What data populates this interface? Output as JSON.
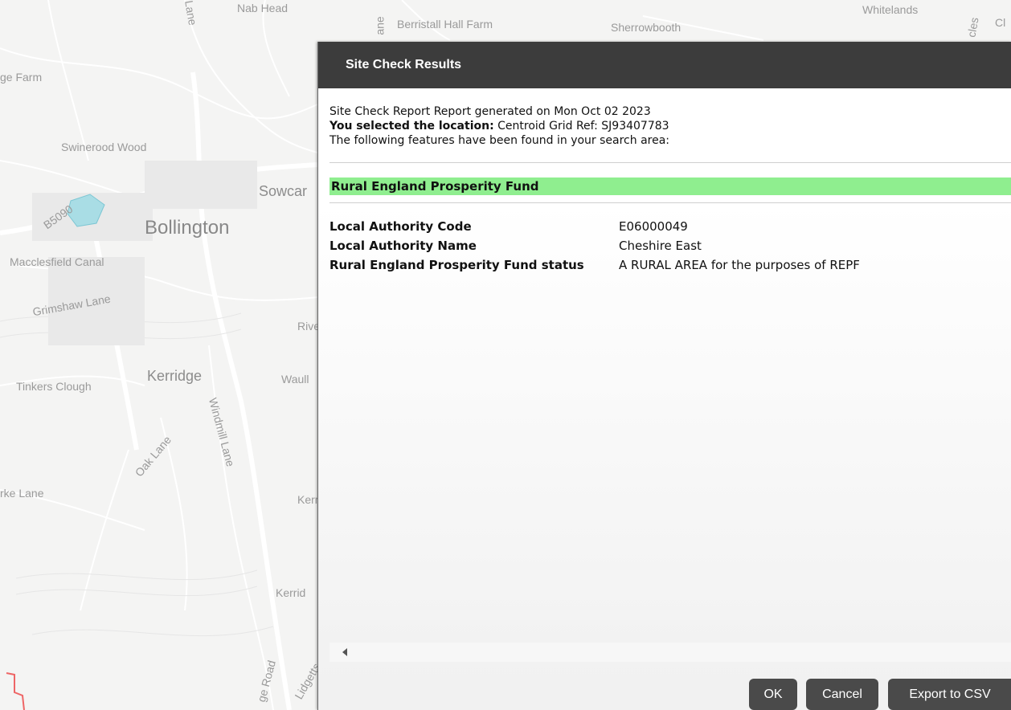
{
  "map": {
    "labels": {
      "nab_head": "Nab Head",
      "berristall": "Berristall Hall Farm",
      "sherrowbooth": "Sherrowbooth",
      "whitelands": "Whitelands",
      "ge_farm": "ge Farm",
      "swinerood": "Swinerood Wood",
      "sowcar": "Sowcar",
      "bollington": "Bollington",
      "b5090": "B5090",
      "macclesfield_canal": "Macclesfield Canal",
      "grimshaw": "Grimshaw Lane",
      "river": "River",
      "tinkers": "Tinkers Clough",
      "kerridge": "Kerridge",
      "waull": "Waull",
      "oak_lane": "Oak Lane",
      "windmill": "Windmill Lane",
      "rke_lane": "rke Lane",
      "kerr": "Kerr",
      "kerrid": "Kerrid",
      "ge_road": "ge Road",
      "lidgetts": "Lidgetts",
      "lane_top": "Lane",
      "ane_top": "ane",
      "cles": "cles",
      "cl": "Cl"
    }
  },
  "dialog": {
    "title": "Site Check Results",
    "intro": {
      "report_line": "Site Check Report Report generated on Mon Oct 02 2023",
      "location_label": "You selected the location:",
      "location_value": " Centroid Grid Ref: SJ93407783",
      "features_line": "The following features have been found in your search area:"
    },
    "section_title": "Rural England Prosperity Fund",
    "attributes": [
      {
        "key": "Local Authority Code",
        "value": "E06000049"
      },
      {
        "key": "Local Authority Name",
        "value": "Cheshire East"
      },
      {
        "key": "Rural England Prosperity Fund status",
        "value": "A RURAL AREA for the purposes of REPF"
      }
    ],
    "buttons": {
      "ok": "OK",
      "cancel": "Cancel",
      "export": "Export to CSV"
    }
  }
}
